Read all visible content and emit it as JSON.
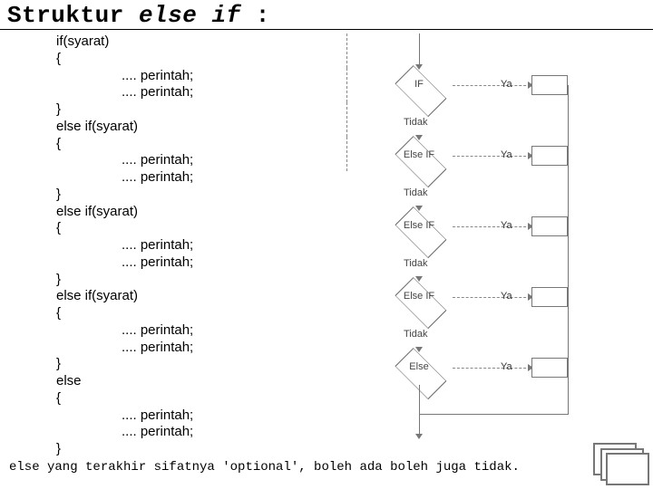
{
  "title": {
    "prefix": "Struktur ",
    "keyword": "else if",
    "suffix": " :"
  },
  "code": {
    "if_line": "if(syarat)",
    "open": "{",
    "close": "}",
    "stmt": ".... perintah;",
    "elseif_line": "else if(syarat)",
    "else_line": "else"
  },
  "footnote": "else yang terakhir sifatnya 'optional', boleh ada boleh juga tidak.",
  "flow": {
    "if": "IF",
    "elseif": "Else IF",
    "else": "Else",
    "yes": "Ya",
    "no": "Tidak"
  }
}
